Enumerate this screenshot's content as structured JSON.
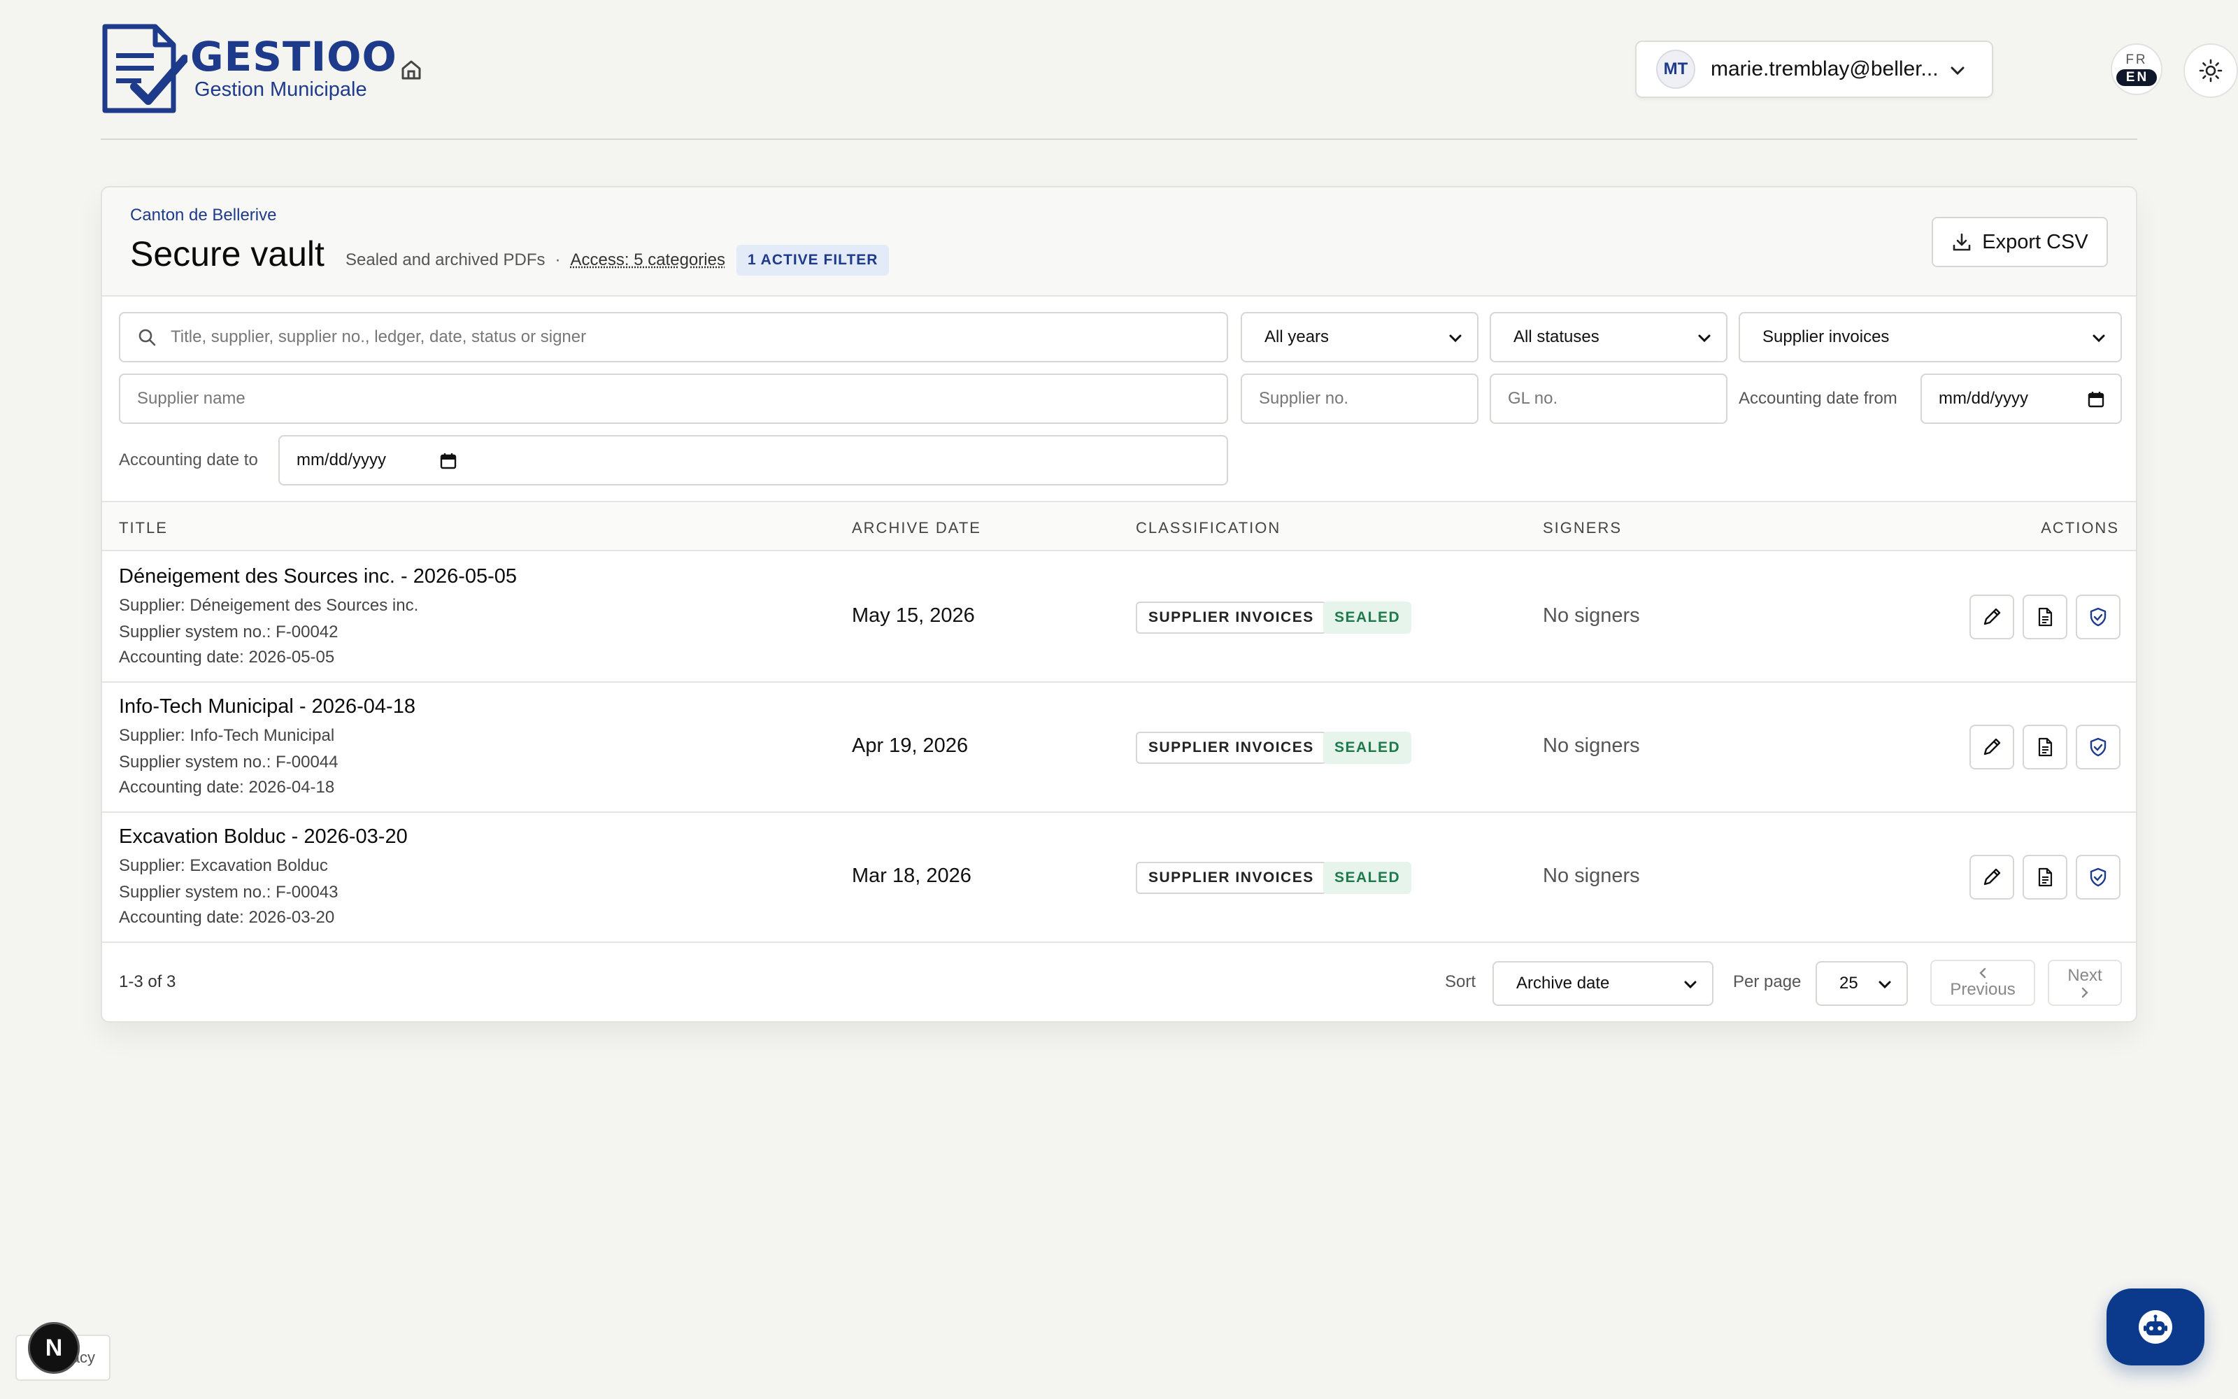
{
  "header": {
    "brand": "GESTIOO",
    "brand_sub": "Gestion Municipale",
    "user_initials": "MT",
    "user_email": "marie.tremblay@beller...",
    "lang_fr": "FR",
    "lang_en": "EN"
  },
  "vault": {
    "breadcrumb": "Canton de Bellerive",
    "title": "Secure vault",
    "subtitle": "Sealed and archived PDFs",
    "separator": "·",
    "access": "Access: 5 categories",
    "active_filter": "1 ACTIVE FILTER",
    "export_label": "Export CSV"
  },
  "filters": {
    "search_placeholder": "Title, supplier, supplier no., ledger, date, status or signer",
    "year": "All years",
    "status": "All statuses",
    "category": "Supplier invoices",
    "supplier_name_placeholder": "Supplier name",
    "supplier_no_placeholder": "Supplier no.",
    "gl_no_placeholder": "GL no.",
    "date_from_label": "Accounting date from",
    "date_from_value": "mm/dd/yyyy",
    "date_to_label": "Accounting date to",
    "date_to_value": "mm/dd/yyyy"
  },
  "table": {
    "columns": [
      "TITLE",
      "ARCHIVE DATE",
      "CLASSIFICATION",
      "SIGNERS",
      "ACTIONS"
    ],
    "rows": [
      {
        "title": "Déneigement des Sources inc. - 2026-05-05",
        "supplier": "Supplier: Déneigement des Sources inc.",
        "system_no": "Supplier system no.: F-00042",
        "accounting_date": "Accounting date: 2026-05-05",
        "archive_date": "May 15, 2026",
        "classification": "SUPPLIER INVOICES",
        "status": "SEALED",
        "signers": "No signers"
      },
      {
        "title": "Info-Tech Municipal - 2026-04-18",
        "supplier": "Supplier: Info-Tech Municipal",
        "system_no": "Supplier system no.: F-00044",
        "accounting_date": "Accounting date: 2026-04-18",
        "archive_date": "Apr 19, 2026",
        "classification": "SUPPLIER INVOICES",
        "status": "SEALED",
        "signers": "No signers"
      },
      {
        "title": "Excavation Bolduc - 2026-03-20",
        "supplier": "Supplier: Excavation Bolduc",
        "system_no": "Supplier system no.: F-00043",
        "accounting_date": "Accounting date: 2026-03-20",
        "archive_date": "Mar 18, 2026",
        "classification": "SUPPLIER INVOICES",
        "status": "SEALED",
        "signers": "No signers"
      }
    ]
  },
  "footer": {
    "count": "1-3 of 3",
    "sort_label": "Sort",
    "sort_value": "Archive date",
    "per_page_label": "Per page",
    "per_page_value": "25",
    "previous": "Previous",
    "next": "Next"
  },
  "floating": {
    "next_badge": "N",
    "privacy_text": "Privacy"
  },
  "colors": {
    "brand": "#1e3a8a",
    "sealed_bg": "#e6f4ec",
    "sealed_text": "#1f7a4b",
    "bot_button": "#0b3a8c"
  }
}
